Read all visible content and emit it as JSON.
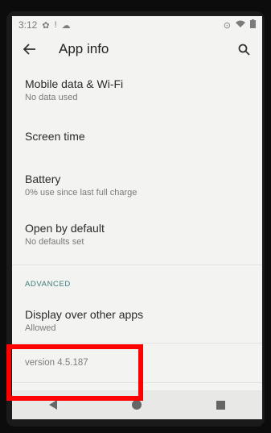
{
  "status_bar": {
    "time": "3:12",
    "left_icons": [
      "gear-icon",
      "alert-icon",
      "cloud-icon"
    ],
    "right_icons": [
      "location-icon",
      "wifi-icon",
      "battery-icon"
    ]
  },
  "app_bar": {
    "title": "App info",
    "back_icon": "arrow-left-icon",
    "search_icon": "search-icon"
  },
  "items": [
    {
      "title": "Mobile data & Wi-Fi",
      "subtitle": "No data used"
    },
    {
      "title": "Screen time",
      "subtitle": ""
    },
    {
      "title": "Battery",
      "subtitle": "0% use since last full charge"
    },
    {
      "title": "Open by default",
      "subtitle": "No defaults set"
    }
  ],
  "section": {
    "label": "ADVANCED"
  },
  "advanced_items": [
    {
      "title": "Display over other apps",
      "subtitle": "Allowed"
    }
  ],
  "version_text": "version 4.5.187",
  "colors": {
    "highlight": "#ff0000",
    "section_accent": "#3a7b7a"
  }
}
